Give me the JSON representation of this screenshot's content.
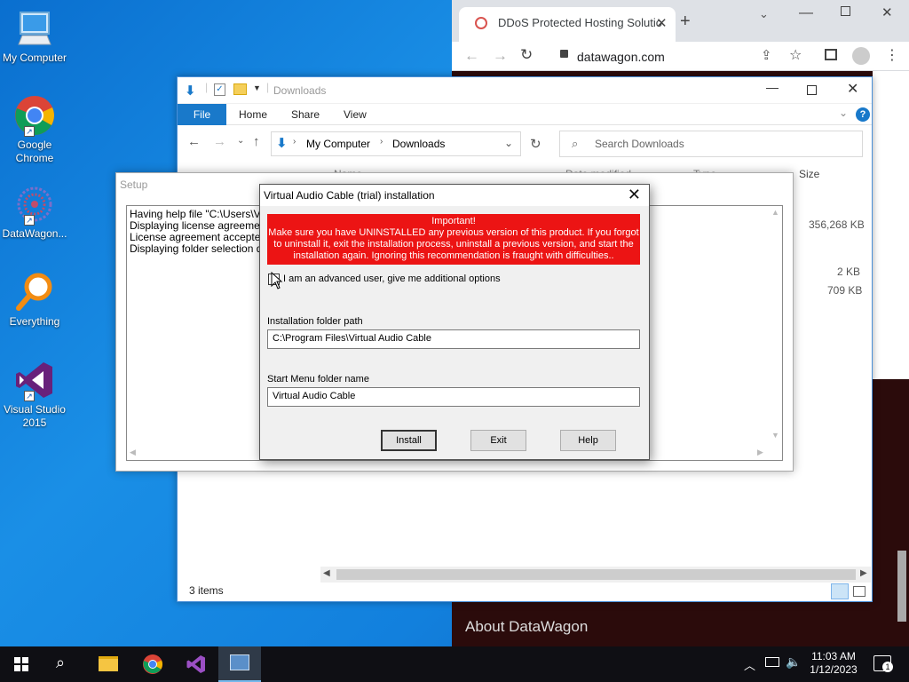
{
  "desktop": {
    "icons": [
      {
        "label": "My Computer"
      },
      {
        "label": "Google Chrome"
      },
      {
        "label": "DataWagon..."
      },
      {
        "label": "Everything"
      },
      {
        "label": "Visual Studio 2015"
      }
    ]
  },
  "chrome": {
    "tab_title": "DDoS Protected Hosting Solutio",
    "url": "datawagon.com",
    "page_text": "About DataWagon"
  },
  "explorer": {
    "title": "Downloads",
    "ribbon_tabs": [
      "File",
      "Home",
      "Share",
      "View"
    ],
    "breadcrumb": [
      "My Computer",
      "Downloads"
    ],
    "search_placeholder": "Search Downloads",
    "columns": [
      "Name",
      "Date modified",
      "Type",
      "Size"
    ],
    "sizes": [
      "356,268 KB",
      "2 KB",
      "709 KB"
    ],
    "status": "3 items"
  },
  "setup": {
    "title": "Setup",
    "log_lines": [
      "Having help file \"C:\\Users\\VM5",
      "Displaying license agreement",
      "License agreement accepted",
      "Displaying folder selection dialo"
    ]
  },
  "vac_dialog": {
    "title": "Virtual Audio Cable (trial) installation",
    "warning_title": "Important!",
    "warning_lines": [
      "Make sure you have UNINSTALLED any previous version of this product. If you forgot",
      "to uninstall it, exit the installation process, uninstall a previous version, and start the",
      "installation again. Ignoring this recommendation is fraught with difficulties.."
    ],
    "advanced_checkbox": "I am an advanced user, give me additional options",
    "install_path_label": "Installation folder path",
    "install_path_value": "C:\\Program Files\\Virtual Audio Cable",
    "start_menu_label": "Start Menu folder name",
    "start_menu_value": "Virtual Audio Cable",
    "buttons": {
      "install": "Install",
      "exit": "Exit",
      "help": "Help"
    }
  },
  "taskbar": {
    "time": "11:03 AM",
    "date": "1/12/2023",
    "notification_count": "1"
  },
  "colors": {
    "warning_bg": "#ec1414",
    "ribbon_file": "#1979ca",
    "desktop_bg": "#1280dd"
  }
}
